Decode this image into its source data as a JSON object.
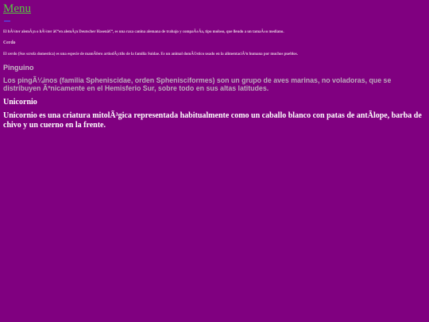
{
  "page": {
    "background": "#800080"
  },
  "nav": {
    "menu_label": "Menu",
    "menu_color": "#57c840"
  },
  "sections": {
    "dog": {
      "text": "El hÃ¼ter alemÃ¡n o hÃ¼ter â€“en alemÃ¡n Deutscher Hasenâ€“, es una raza canina alemana de trabajo y compaÃ±Ã­a, tipo moloso, que lleudo a un tamaÃ±o mediano."
    },
    "pig": {
      "title": "Cerdo",
      "text": "El cerdo (Sus scrofa domestica) es una especie de mamÃfero artiodÃ¡ctilo de la familia Suidae. Es un animal domÃ©stico usado en la alimentaciÃ³n humana por muchos pueblos."
    },
    "penguin": {
      "title": "Pinguino",
      "text": "Los pingÃ¼inos (familia Spheniscidae, orden Sphenisciformes) son un grupo de aves marinas, no voladoras, que se distribuyen Ãºnicamente en el Hemisferio Sur, sobre todo en sus altas latitudes."
    },
    "unicorn": {
      "title": "Unicornio",
      "text": "Unicornio es una criatura mitolÃ³gica representada habitualmente como un caballo blanco con patas de antÃlope, barba de chivo y un cuerno en la frente."
    }
  }
}
